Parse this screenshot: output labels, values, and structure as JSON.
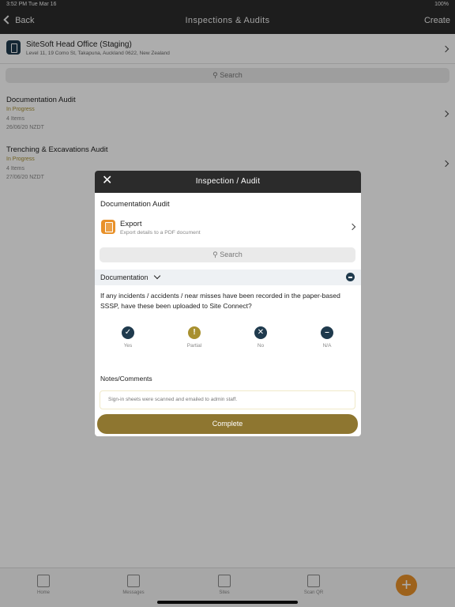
{
  "status_bar": {
    "time": "3:52 PM   Tue Mar 16",
    "right": "100%"
  },
  "nav": {
    "back_label": "Back",
    "title": "Inspections & Audits",
    "create_label": "Create"
  },
  "site": {
    "name": "SiteSoft Head Office (Staging)",
    "address": "Level 11, 19 Como St, Takapuna, Auckland 0622, New Zealand"
  },
  "search": {
    "placeholder": "Search"
  },
  "audits": [
    {
      "title": "Documentation Audit",
      "status": "In Progress",
      "items": "4 Items",
      "date": "26/06/20 NZDT"
    },
    {
      "title": "Trenching & Excavations Audit",
      "status": "In Progress",
      "items": "4 Items",
      "date": "27/06/20 NZDT"
    }
  ],
  "tabs": [
    {
      "label": "Home"
    },
    {
      "label": "Messages"
    },
    {
      "label": "Sites"
    },
    {
      "label": "Scan QR"
    }
  ],
  "modal": {
    "title": "Inspection / Audit",
    "audit_title": "Documentation Audit",
    "export_label": "Export",
    "export_sub": "Export details to a PDF document",
    "search_placeholder": "Search",
    "section_label": "Documentation",
    "question": "If any incidents / accidents / near misses have been recorded in the paper-based SSSP, have these been uploaded to Site Connect?",
    "options": [
      {
        "label": "Yes",
        "color": "#1f3a4d",
        "glyph": "✓"
      },
      {
        "label": "Partial",
        "color": "#a8902f",
        "glyph": "!"
      },
      {
        "label": "No",
        "color": "#1f3a4d",
        "glyph": "✕"
      },
      {
        "label": "N/A",
        "color": "#1f3a4d",
        "glyph": "–"
      }
    ],
    "notes_label": "Notes/Comments",
    "notes_value": "Sign-in sheets were scanned and emailed to admin staff.",
    "complete_label": "Complete"
  },
  "colors": {
    "accent_gold": "#8e7630",
    "navy": "#1f3a4d",
    "orange": "#e8912a"
  }
}
